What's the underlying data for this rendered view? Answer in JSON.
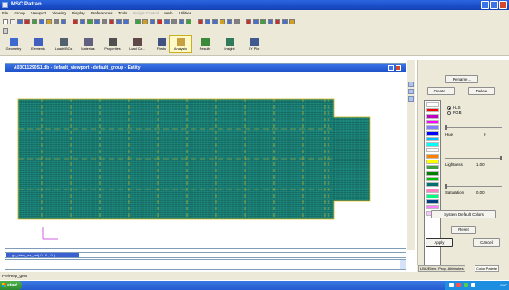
{
  "window": {
    "title": "MSC.Patran"
  },
  "menu": {
    "items": [
      "File",
      "Group",
      "Viewport",
      "Viewing",
      "Display",
      "Preferences",
      "Tools",
      "Insight Control",
      "Help",
      "Utilities"
    ],
    "disabled_index": 7
  },
  "apps": {
    "items": [
      "Geometry",
      "Elements",
      "Loads/BCs",
      "Materials",
      "Properties",
      "Load Ca...",
      "Fields",
      "Analysis",
      "Results",
      "Insight",
      "XY Plot"
    ],
    "selected_index": 7
  },
  "viewport": {
    "title": "A03011290S1.db - default_viewport - default_group - Entity",
    "background": "#ffffff",
    "mesh_color": "#1f8a80",
    "mesh_line_color": "#0b4a44",
    "edge_color": "#e8c020"
  },
  "command": {
    "history_line": "ga_view_aa_set( 0., 0., 0. )",
    "input_value": ""
  },
  "status": {
    "text": "Pre/Help_gros"
  },
  "panel": {
    "buttons": {
      "rename": "Rename...",
      "create": "Create...",
      "delete": "Delete",
      "system_default": "System Default Colors",
      "reset": "Reset",
      "apply": "Apply",
      "cancel": "Cancel"
    },
    "radio": {
      "hls": "HLS",
      "rgb": "RGB",
      "selected": "hls"
    },
    "hue": {
      "label": "Hue",
      "value": "0"
    },
    "lightness": {
      "label": "Lightness",
      "value": "1.00"
    },
    "saturation": {
      "label": "Saturation",
      "value": "0.00"
    },
    "swatches": [
      "#ffffff",
      "#ff0000",
      "#c000c0",
      "#ff00ff",
      "#8080ff",
      "#0000ff",
      "#00c0ff",
      "#00ffff",
      "#ffffff",
      "#ff8000",
      "#ffff00",
      "#40a040",
      "#008000",
      "#00c000",
      "#007070",
      "#ff80c0",
      "#00ff80",
      "#004080",
      "#ff80ff",
      "#ffc0ff"
    ]
  },
  "tabs": {
    "items": [
      "LBC/Elem. Prop. Attributes",
      "Color Palette"
    ],
    "active_index": 1
  },
  "taskbar": {
    "start_label": "start",
    "clock": "CAF"
  }
}
